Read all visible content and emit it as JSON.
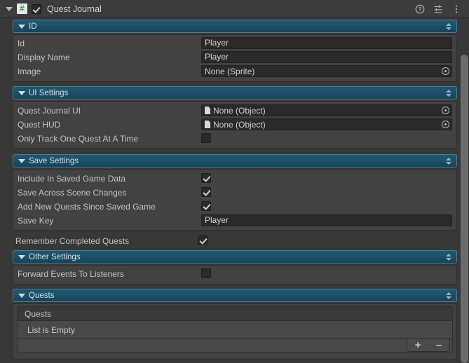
{
  "window": {
    "title": "Quest Journal",
    "component_enabled": true,
    "icons": {
      "foldout": "triangle-down-icon",
      "script": "script-icon",
      "enabled_checkbox": "component-enabled-checkbox",
      "help": "help-icon",
      "preset": "preset-icon",
      "menu": "kebab-menu-icon"
    }
  },
  "colors": {
    "background": "#383838",
    "section_header_blue": "#1c5169",
    "group_box": "#424242",
    "field_background": "#2a2a2a",
    "list_body": "#484848",
    "text": "#c2c2c2",
    "script_icon_green": "#36a03a"
  },
  "sections": [
    {
      "title": "ID",
      "expanded": true,
      "rows": [
        {
          "label": "Id",
          "type": "text",
          "value": "Player"
        },
        {
          "label": "Display Name",
          "type": "text",
          "value": "Player"
        },
        {
          "label": "Image",
          "type": "object",
          "value": "None (Sprite)"
        }
      ]
    },
    {
      "title": "UI Settings",
      "expanded": true,
      "rows": [
        {
          "label": "Quest Journal UI",
          "type": "object",
          "value": "None (Object)"
        },
        {
          "label": "Quest HUD",
          "type": "object",
          "value": "None (Object)"
        },
        {
          "label": "Only Track One Quest At A Time",
          "type": "checkbox",
          "checked": false
        }
      ]
    },
    {
      "title": "Save Settings",
      "expanded": true,
      "rows": [
        {
          "label": "Include In Saved Game Data",
          "type": "checkbox",
          "checked": true
        },
        {
          "label": "Save Across Scene Changes",
          "type": "checkbox",
          "checked": true
        },
        {
          "label": "Add New Quests Since Saved Game",
          "type": "checkbox",
          "checked": true
        },
        {
          "label": "Save Key",
          "type": "text",
          "value": "Player"
        }
      ]
    },
    {
      "title": "Other Settings",
      "expanded": true,
      "rows": [
        {
          "label": "Forward Events To Listeners",
          "type": "checkbox",
          "checked": false
        }
      ]
    },
    {
      "title": "Quests",
      "expanded": true,
      "rows": []
    }
  ],
  "loose_rows": [
    {
      "label": "Remember Completed Quests",
      "type": "checkbox",
      "checked": true
    }
  ],
  "quests_list": {
    "header": "Quests",
    "empty_text": "List is Empty",
    "add_button": "+",
    "remove_button": "–"
  }
}
